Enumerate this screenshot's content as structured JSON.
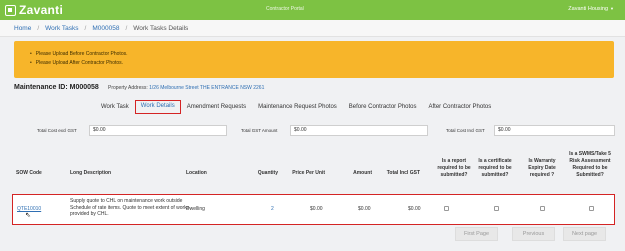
{
  "app": {
    "logo_text": "Zavanti",
    "portal_label": "Contractor Portal",
    "user_name": "Zavanti Housing"
  },
  "breadcrumb": [
    "Home",
    "Work Tasks",
    "M000058",
    "Work Tasks Details"
  ],
  "alerts": [
    "Please Upload Before Contractor Photos.",
    "Please Upload After Contractor Photos."
  ],
  "header": {
    "maintenance_label": "Maintenance ID:",
    "maintenance_id": "M000058",
    "property_label": "Property Address:",
    "property_address": "1/26 Melbourne Street THE ENTRANCE NSW 2261"
  },
  "tabs": [
    {
      "label": "Work Task",
      "active": false
    },
    {
      "label": "Work Details",
      "active": true
    },
    {
      "label": "Amendment Requests",
      "active": false
    },
    {
      "label": "Maintenance Request Photos",
      "active": false
    },
    {
      "label": "Before Contractor Photos",
      "active": false
    },
    {
      "label": "After Contractor Photos",
      "active": false
    }
  ],
  "totals": [
    {
      "label": "Total Cost excl GST",
      "value": "$0.00"
    },
    {
      "label": "Total GST Amount",
      "value": "$0.00"
    },
    {
      "label": "Total Cost Incl GST",
      "value": "$0.00"
    }
  ],
  "table": {
    "columns": {
      "sow_code": "SOW Code",
      "long_description": "Long Description",
      "location": "Location",
      "quantity": "Quantity",
      "price_per_unit": "Price Per Unit",
      "amount": "Amount",
      "total_incl_gst": "Total Incl GST",
      "report_required": "Is a report required to be submitted?",
      "certificate_required": "Is a certificate required to be submitted?",
      "warranty_expiry": "Is Warranty Expiry Date required ?",
      "swms_required": "Is a SWMS/Take 5 Risk Assessment Required to be Submitted?"
    },
    "rows": [
      {
        "sow_code": "QTE10010",
        "long_description": "Supply quote to CHL on maintenance work outside Schedule of rate items. Quote to meet extent of works provided by CHL.",
        "location": "Dwelling",
        "quantity": "2",
        "price_per_unit": "$0.00",
        "amount": "$0.00",
        "total_incl_gst": "$0.00",
        "report_required": false,
        "certificate_required": false,
        "warranty_expiry": false,
        "swms_required": false
      }
    ]
  },
  "pagination": {
    "first": "First Page",
    "previous": "Previous",
    "next": "Next page"
  },
  "colors": {
    "brand_green": "#7dc243",
    "alert_amber": "#f7b52a",
    "highlight_red": "#d42424",
    "link_blue": "#2f6fb3"
  }
}
